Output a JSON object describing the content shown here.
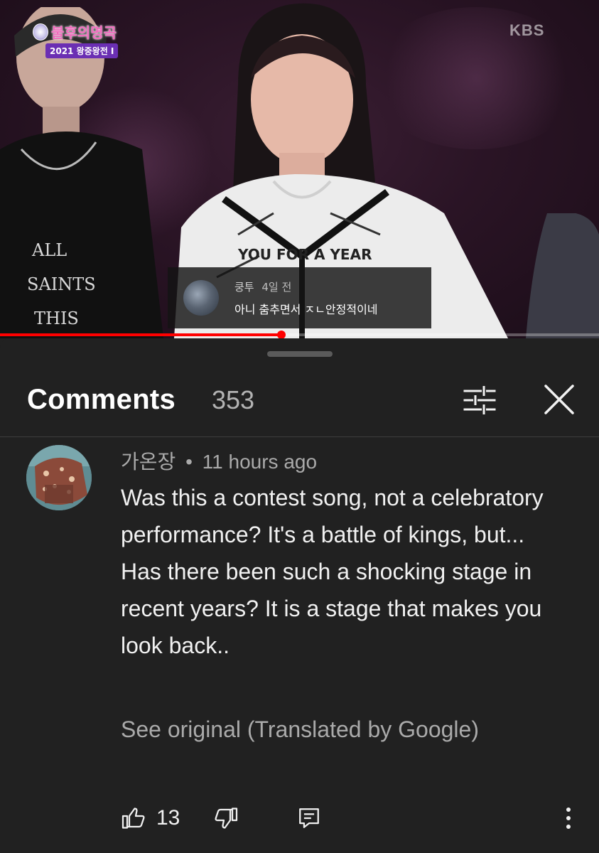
{
  "video": {
    "show_title": "불후의명곡",
    "show_subtitle": "2021 왕중왕전 I",
    "broadcaster": "KBS",
    "progress_fraction": 0.47,
    "live_chat": {
      "author": "쿵투",
      "time": "4일 전",
      "text": "아니 춤추면서 ㅈㄴ안정적이네"
    }
  },
  "comments_panel": {
    "title": "Comments",
    "count": "353",
    "icons": {
      "sort": "sliders-icon",
      "close": "close-icon"
    }
  },
  "comment": {
    "author": "가온장",
    "separator": "•",
    "time": "11 hours ago",
    "text_lines": [
      "Was this a contest song, not a celebratory performance? It's a battle of kings, but...",
      "Has there been such a shocking stage in recent years? It is a stage that makes you look back.."
    ],
    "see_original": "See original (Translated by Google)",
    "like_count": "13",
    "icons": {
      "like": "thumbs-up-icon",
      "dislike": "thumbs-down-icon",
      "reply": "reply-icon",
      "more": "more-vert-icon"
    }
  },
  "colors": {
    "background": "#212121",
    "progress": "#ff0000",
    "secondary_text": "#aaaaaa"
  }
}
